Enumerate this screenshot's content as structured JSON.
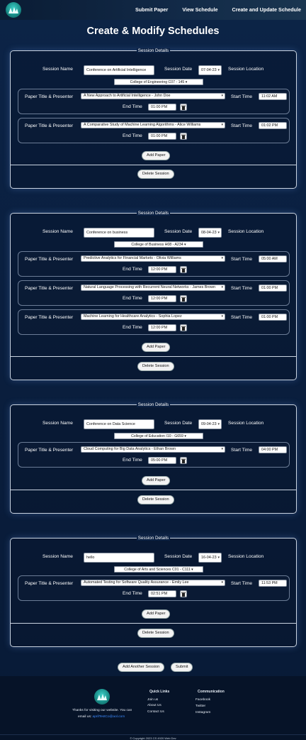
{
  "nav": {
    "submit": "Submit Paper",
    "view": "View Schedule",
    "update": "Create and Update Schedule"
  },
  "page_title": "Create & Modify Schedules",
  "labels": {
    "legend": "Session Details",
    "session_name": "Session Name",
    "session_date": "Session Date",
    "session_location": "Session Location",
    "paper_title": "Paper Title & Presenter",
    "start_time": "Start Time",
    "end_time": "End Time",
    "add_paper": "Add Paper",
    "delete_session": "Delete Session"
  },
  "sessions": [
    {
      "name": "Conference on Artificial Intelligence",
      "date": "07-04-23",
      "venue": "College of Engineering C07 - 145",
      "papers": [
        {
          "title": "A New Approach to Artificial Intelligence - John Doe",
          "start": "11:02 AM",
          "end": "01:00 PM"
        },
        {
          "title": "A Comparative Study of Machine Learning Algorithms - Alice Williams",
          "start": "01:02 PM",
          "end": "01:00 PM"
        }
      ]
    },
    {
      "name": "Conference on business",
      "date": "08-04-23",
      "venue": "College of Business H08 - A234",
      "papers": [
        {
          "title": "Predictive Analytics for Financial Markets - Olivia Williams",
          "start": "05:00 AM",
          "end": "12:00 PM"
        },
        {
          "title": "Natural Language Processing with Recurrent Neural Networks - James Brown",
          "start": "01:00 PM",
          "end": "12:00 PM"
        },
        {
          "title": "Machine Learning for Healthcare Analytics - Sophia Lopez",
          "start": "01:00 PM",
          "end": "12:00 PM"
        }
      ]
    },
    {
      "name": "Conference on Data Science",
      "date": "09-04-23",
      "venue": "College of Education I10 - G659",
      "papers": [
        {
          "title": "Cloud Computing for Big Data Analytics - Ethan Brown",
          "start": "04:00 PM",
          "end": "05:00 PM"
        }
      ]
    },
    {
      "name": "hello",
      "date": "16-04-23",
      "venue": "College of Arts and Sciences C01 - C111",
      "papers": [
        {
          "title": "Automated Testing for Software Quality Assurance - Emily Lee",
          "start": "11:53 PM",
          "end": "02:51 PM"
        }
      ]
    }
  ],
  "actions": {
    "add_session": "Add Another Session",
    "submit": "Submit"
  },
  "footer": {
    "thanks": "Thanks for visiting our website. You can",
    "email_prefix": "email us:",
    "email": "aprilTestCo@aol.com",
    "quick_links_heading": "Quick Links",
    "quick_links": [
      "Join us",
      "About Us",
      "Contact Us"
    ],
    "communication_heading": "Communication",
    "communication": [
      "Facebook",
      "Twitter",
      "Instagram"
    ],
    "copyright": "© Copyright 2023 CS 4920 Web Dev"
  }
}
